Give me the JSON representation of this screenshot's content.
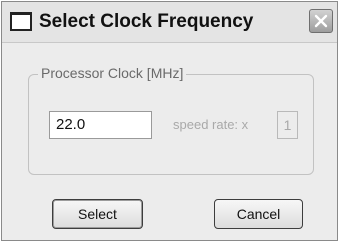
{
  "window": {
    "title": "Select Clock Frequency",
    "icons": {
      "app": "window-icon",
      "close": "close-icon"
    }
  },
  "group": {
    "label": "Processor Clock [MHz]"
  },
  "clock": {
    "value": "22.0"
  },
  "speed": {
    "label": "speed rate: x",
    "value": "1"
  },
  "buttons": {
    "select_label": "Select",
    "cancel_label": "Cancel"
  }
}
